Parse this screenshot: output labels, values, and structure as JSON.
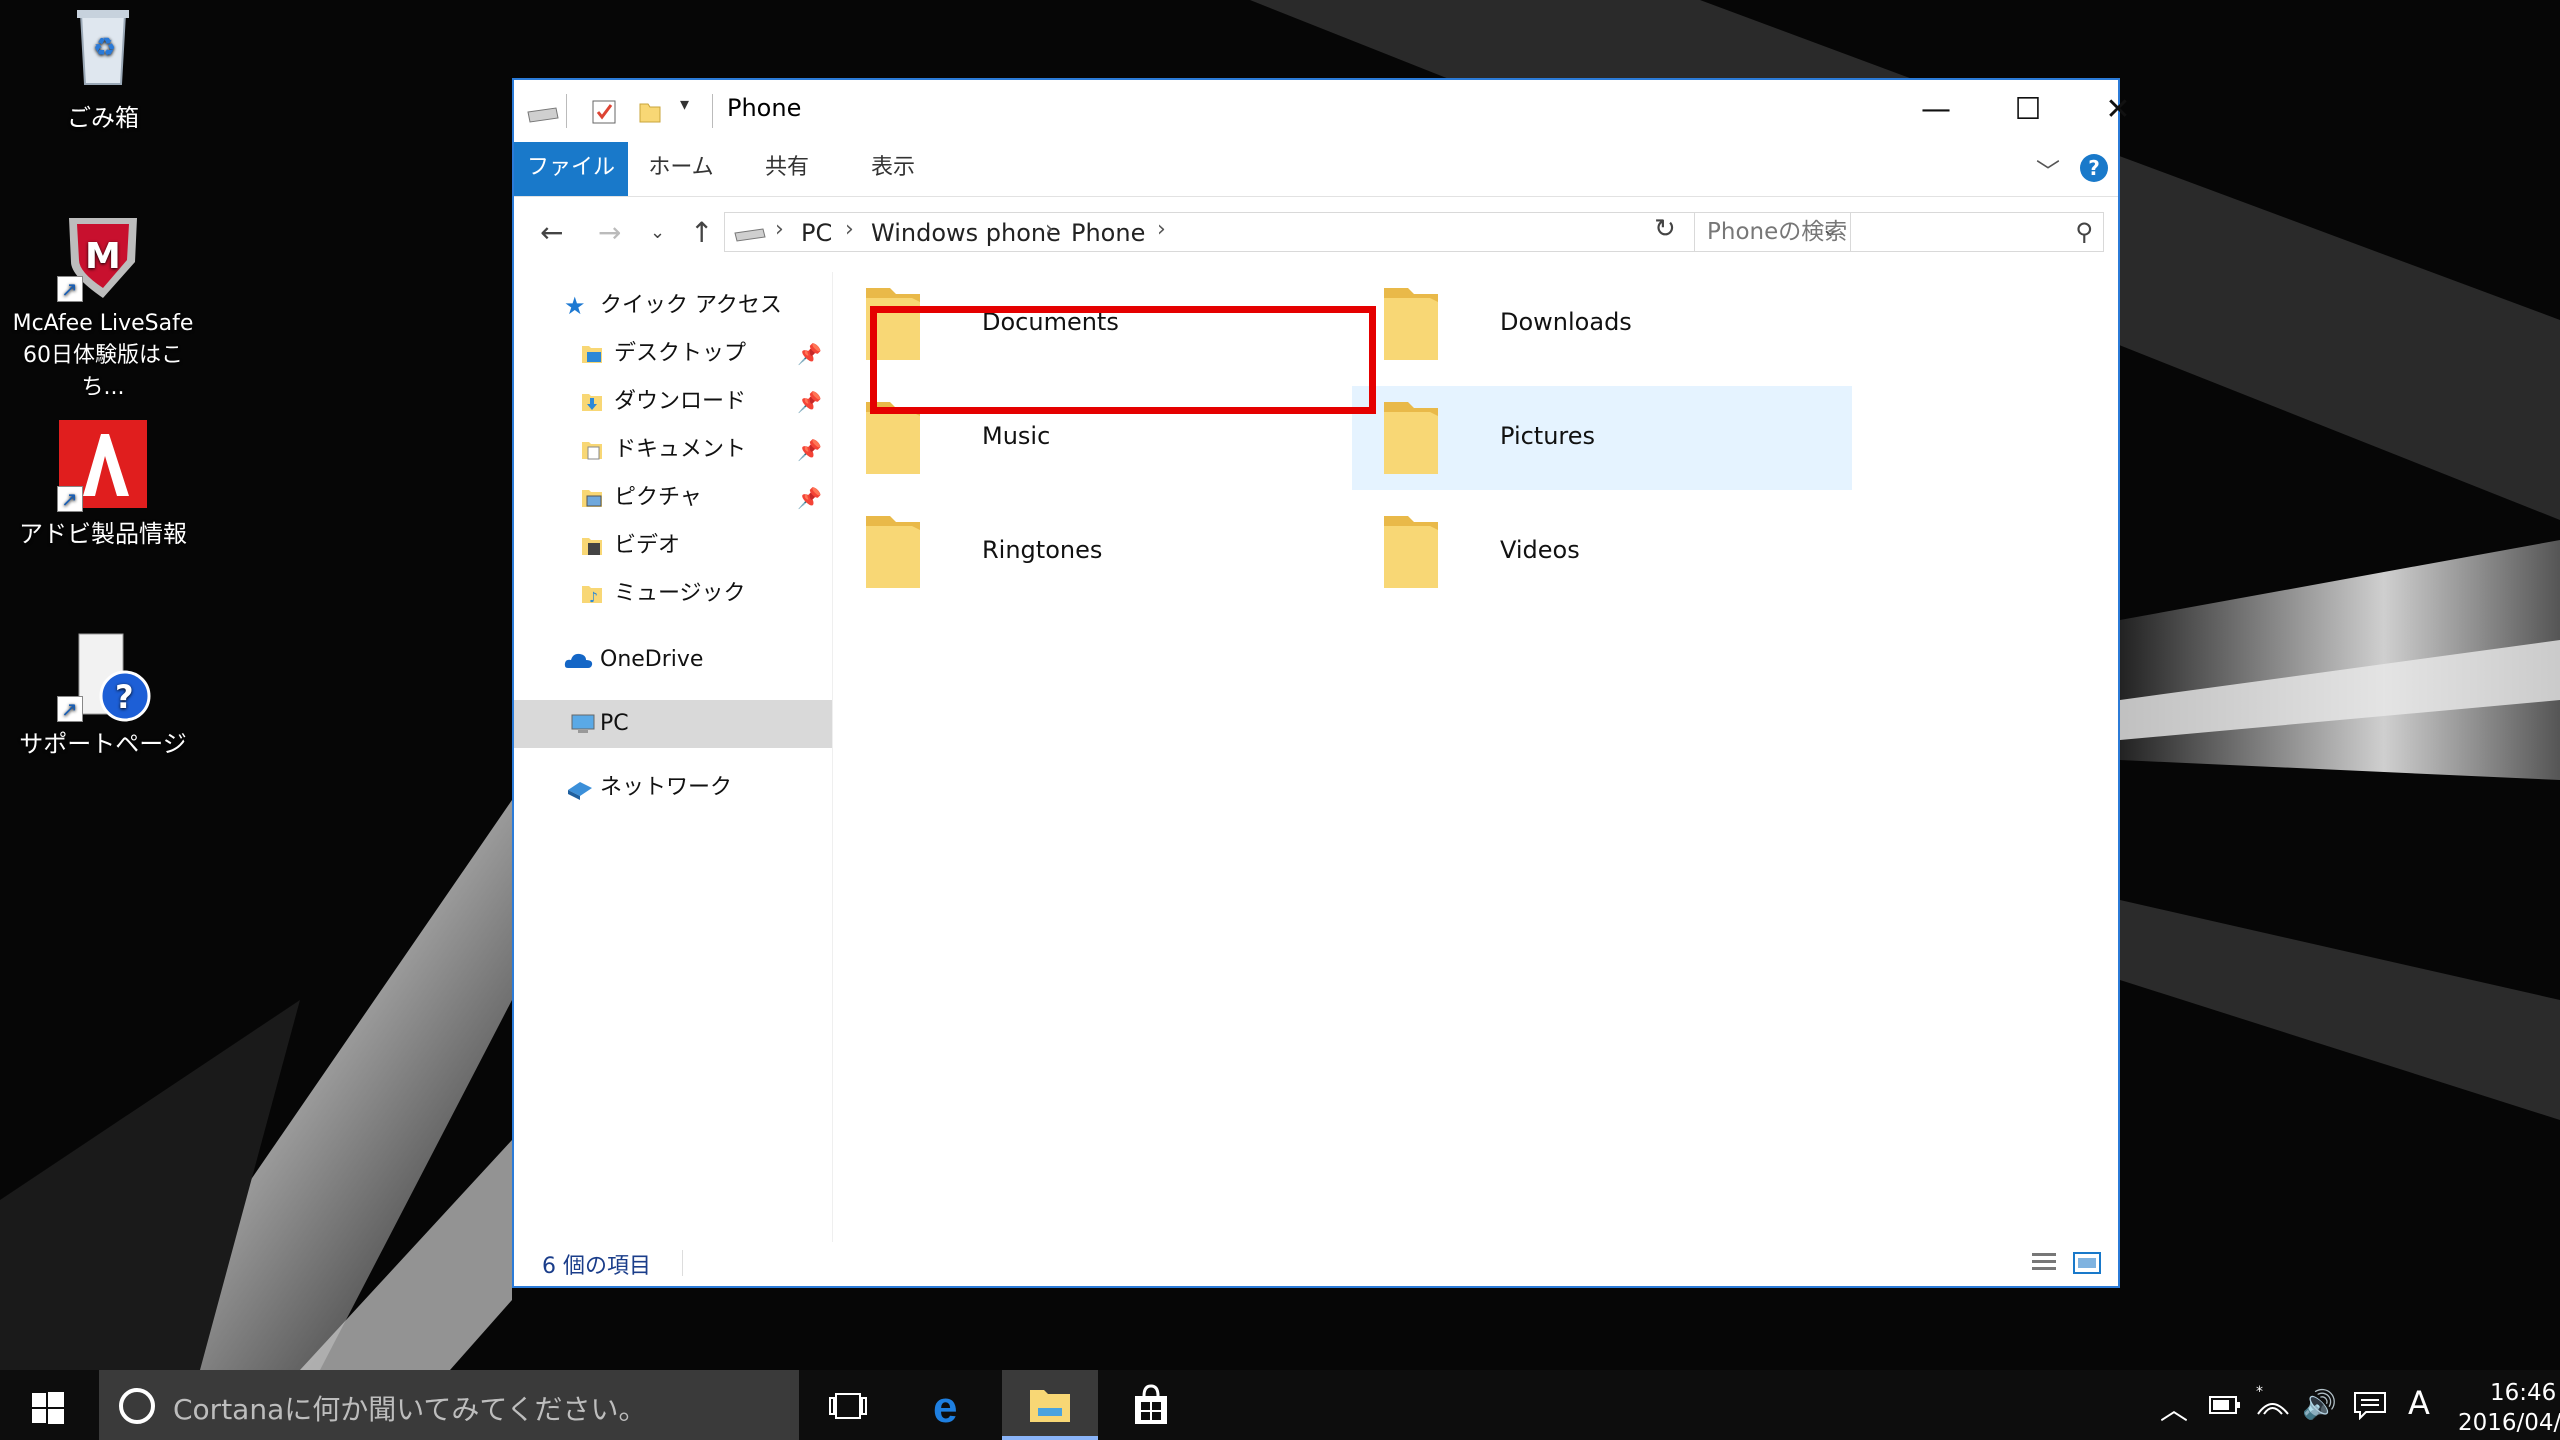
{
  "desktop": {
    "icons": [
      {
        "label": "ごみ箱"
      },
      {
        "label": "McAfee LiveSafe 60日体験版はこち..."
      },
      {
        "label": "アドビ製品情報"
      },
      {
        "label": "サポートページ"
      }
    ]
  },
  "window": {
    "title": "Phone",
    "controls": {
      "minimize": "—",
      "maximize": "☐",
      "close": "✕"
    },
    "ribbon": {
      "tabs": [
        {
          "label": "ファイル"
        },
        {
          "label": "ホーム"
        },
        {
          "label": "共有"
        },
        {
          "label": "表示"
        }
      ],
      "help": "?"
    },
    "address": {
      "crumbs": [
        "PC",
        "Windows phone",
        "Phone"
      ],
      "search_placeholder": "Phoneの検索"
    },
    "nav": {
      "quick_access": "クイック アクセス",
      "items": [
        {
          "label": "デスクトップ",
          "pinned": true
        },
        {
          "label": "ダウンロード",
          "pinned": true
        },
        {
          "label": "ドキュメント",
          "pinned": true
        },
        {
          "label": "ピクチャ",
          "pinned": true
        },
        {
          "label": "ビデオ",
          "pinned": false
        },
        {
          "label": "ミュージック",
          "pinned": false
        }
      ],
      "onedrive": "OneDrive",
      "pc": "PC",
      "network": "ネットワーク"
    },
    "folders": [
      {
        "name": "Documents"
      },
      {
        "name": "Downloads"
      },
      {
        "name": "Music"
      },
      {
        "name": "Pictures",
        "selected": true
      },
      {
        "name": "Ringtones"
      },
      {
        "name": "Videos"
      }
    ],
    "status": {
      "count": "6 個の項目"
    },
    "colors": {
      "accent": "#1979ca",
      "selection": "#e5f3ff",
      "highlight": "#e50000"
    }
  },
  "taskbar": {
    "search_placeholder": "Cortanaに何か聞いてみてください。",
    "ime": "A",
    "time": "16:46",
    "date": "2016/04/"
  }
}
